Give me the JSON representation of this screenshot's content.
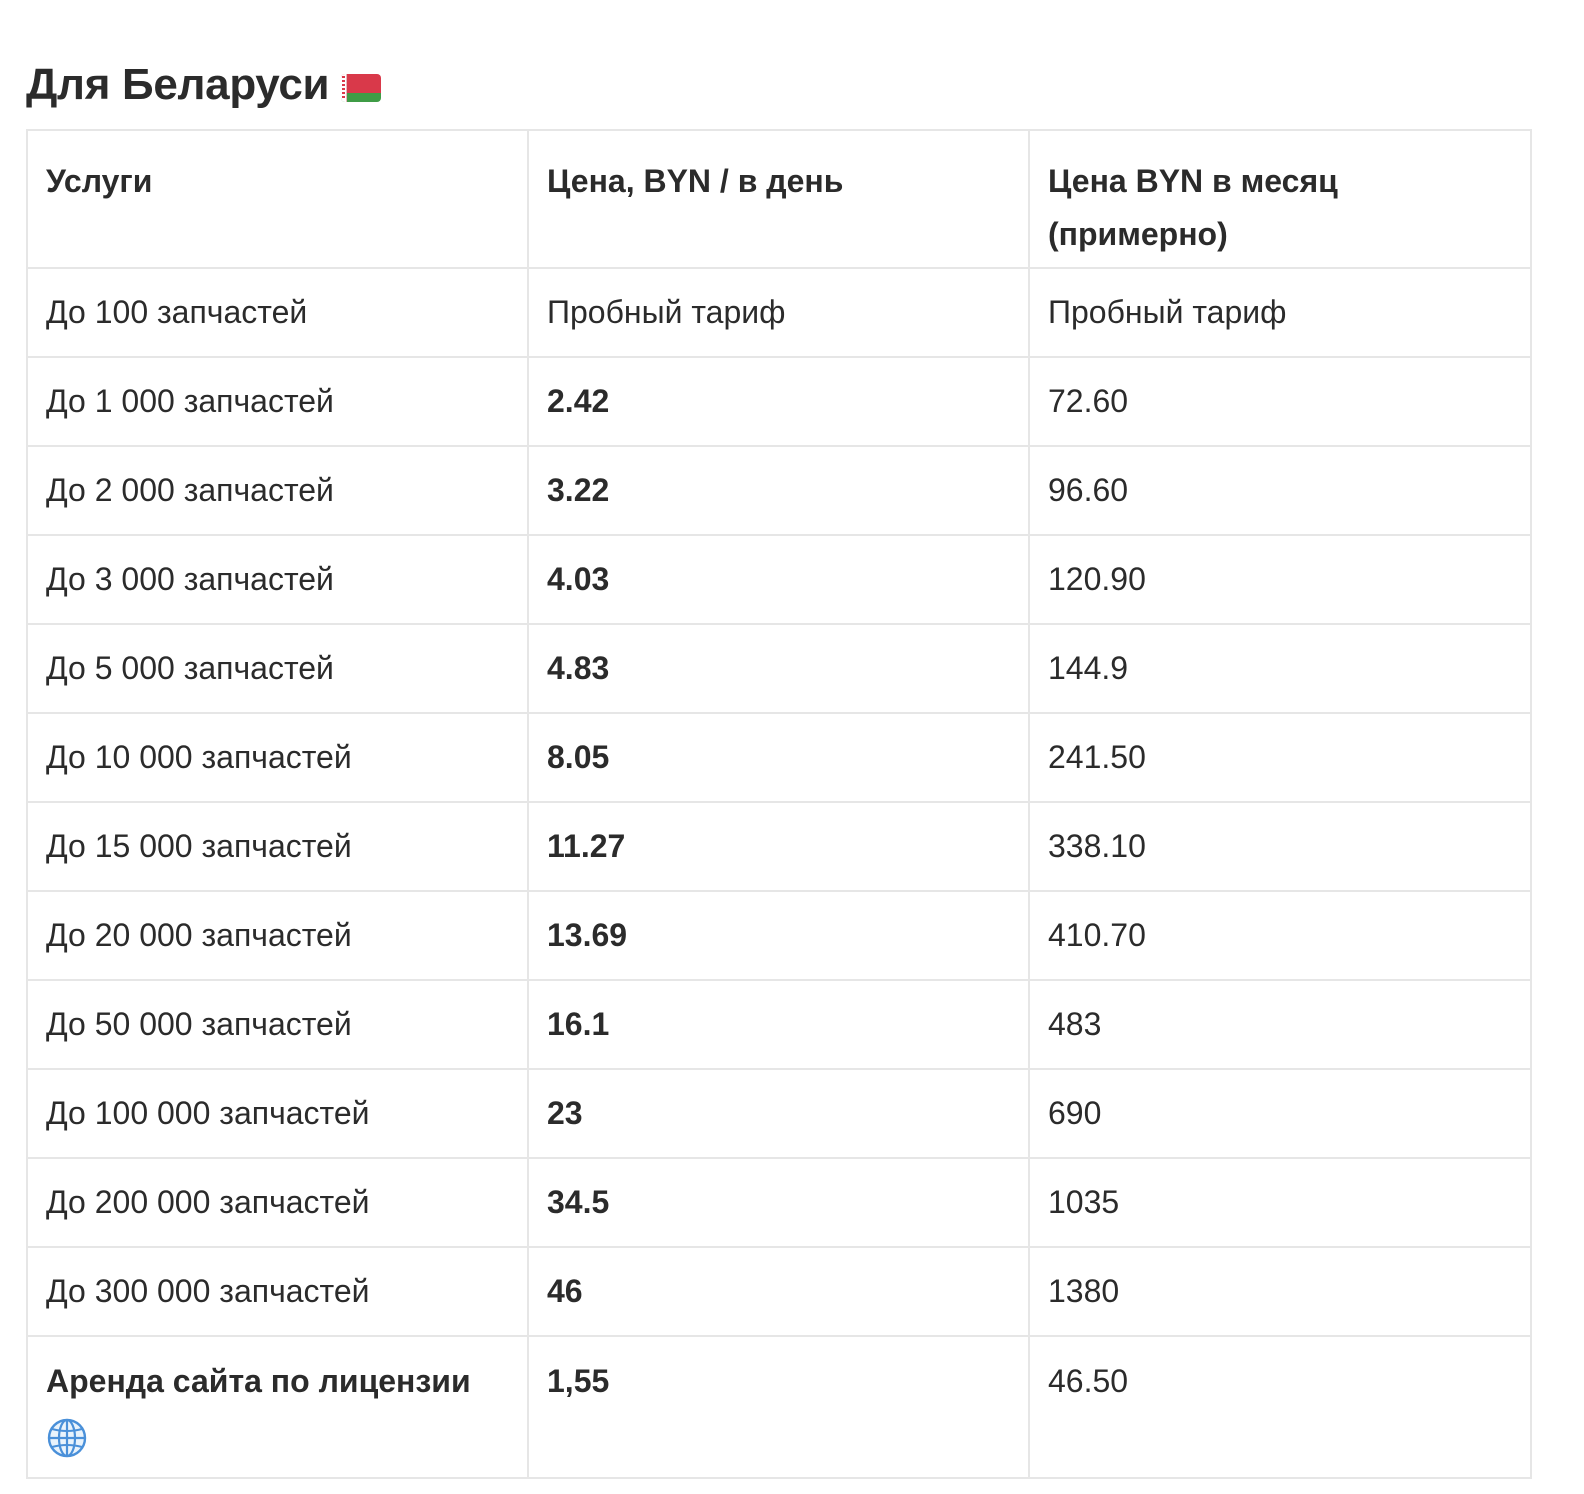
{
  "heading": {
    "title": "Для Беларуси",
    "flag_icon": "belarus-flag-icon"
  },
  "table": {
    "headers": [
      "Услуги",
      "Цена, BYN / в день",
      "Цена BYN в месяц (примерно)"
    ],
    "rows": [
      {
        "service": "До 100 запчастей",
        "per_day": "Пробный тариф",
        "per_month": "Пробный тариф"
      },
      {
        "service": "До 1 000 запчастей",
        "per_day": "2.42",
        "per_month": "72.60"
      },
      {
        "service": "До 2 000 запчастей",
        "per_day": "3.22",
        "per_month": "96.60"
      },
      {
        "service": "До 3 000 запчастей",
        "per_day": "4.03",
        "per_month": "120.90"
      },
      {
        "service": "До 5 000 запчастей",
        "per_day": "4.83",
        "per_month": "144.9"
      },
      {
        "service": "До 10 000 запчастей",
        "per_day": "8.05",
        "per_month": "241.50"
      },
      {
        "service": "До 15 000 запчастей",
        "per_day": "11.27",
        "per_month": "338.10"
      },
      {
        "service": "До 20 000 запчастей",
        "per_day": "13.69",
        "per_month": "410.70"
      },
      {
        "service": "До 50 000 запчастей",
        "per_day": "16.1",
        "per_month": "483"
      },
      {
        "service": "До 100 000 запчастей",
        "per_day": "23",
        "per_month": "690"
      },
      {
        "service": "До 200 000 запчастей",
        "per_day": "34.5",
        "per_month": "1035"
      },
      {
        "service": "До 300 000 запчастей",
        "per_day": "46",
        "per_month": "1380"
      }
    ],
    "last_row": {
      "service": "Аренда сайта по лицензии",
      "service_icon": "globe-icon",
      "per_day": "1,55",
      "per_month": "46.50"
    }
  },
  "colors": {
    "text": "#2b2b2b",
    "border": "#e6e6e6",
    "globe": "#4a90d9",
    "flag_red": "#d9394a",
    "flag_green": "#3f9c46"
  }
}
